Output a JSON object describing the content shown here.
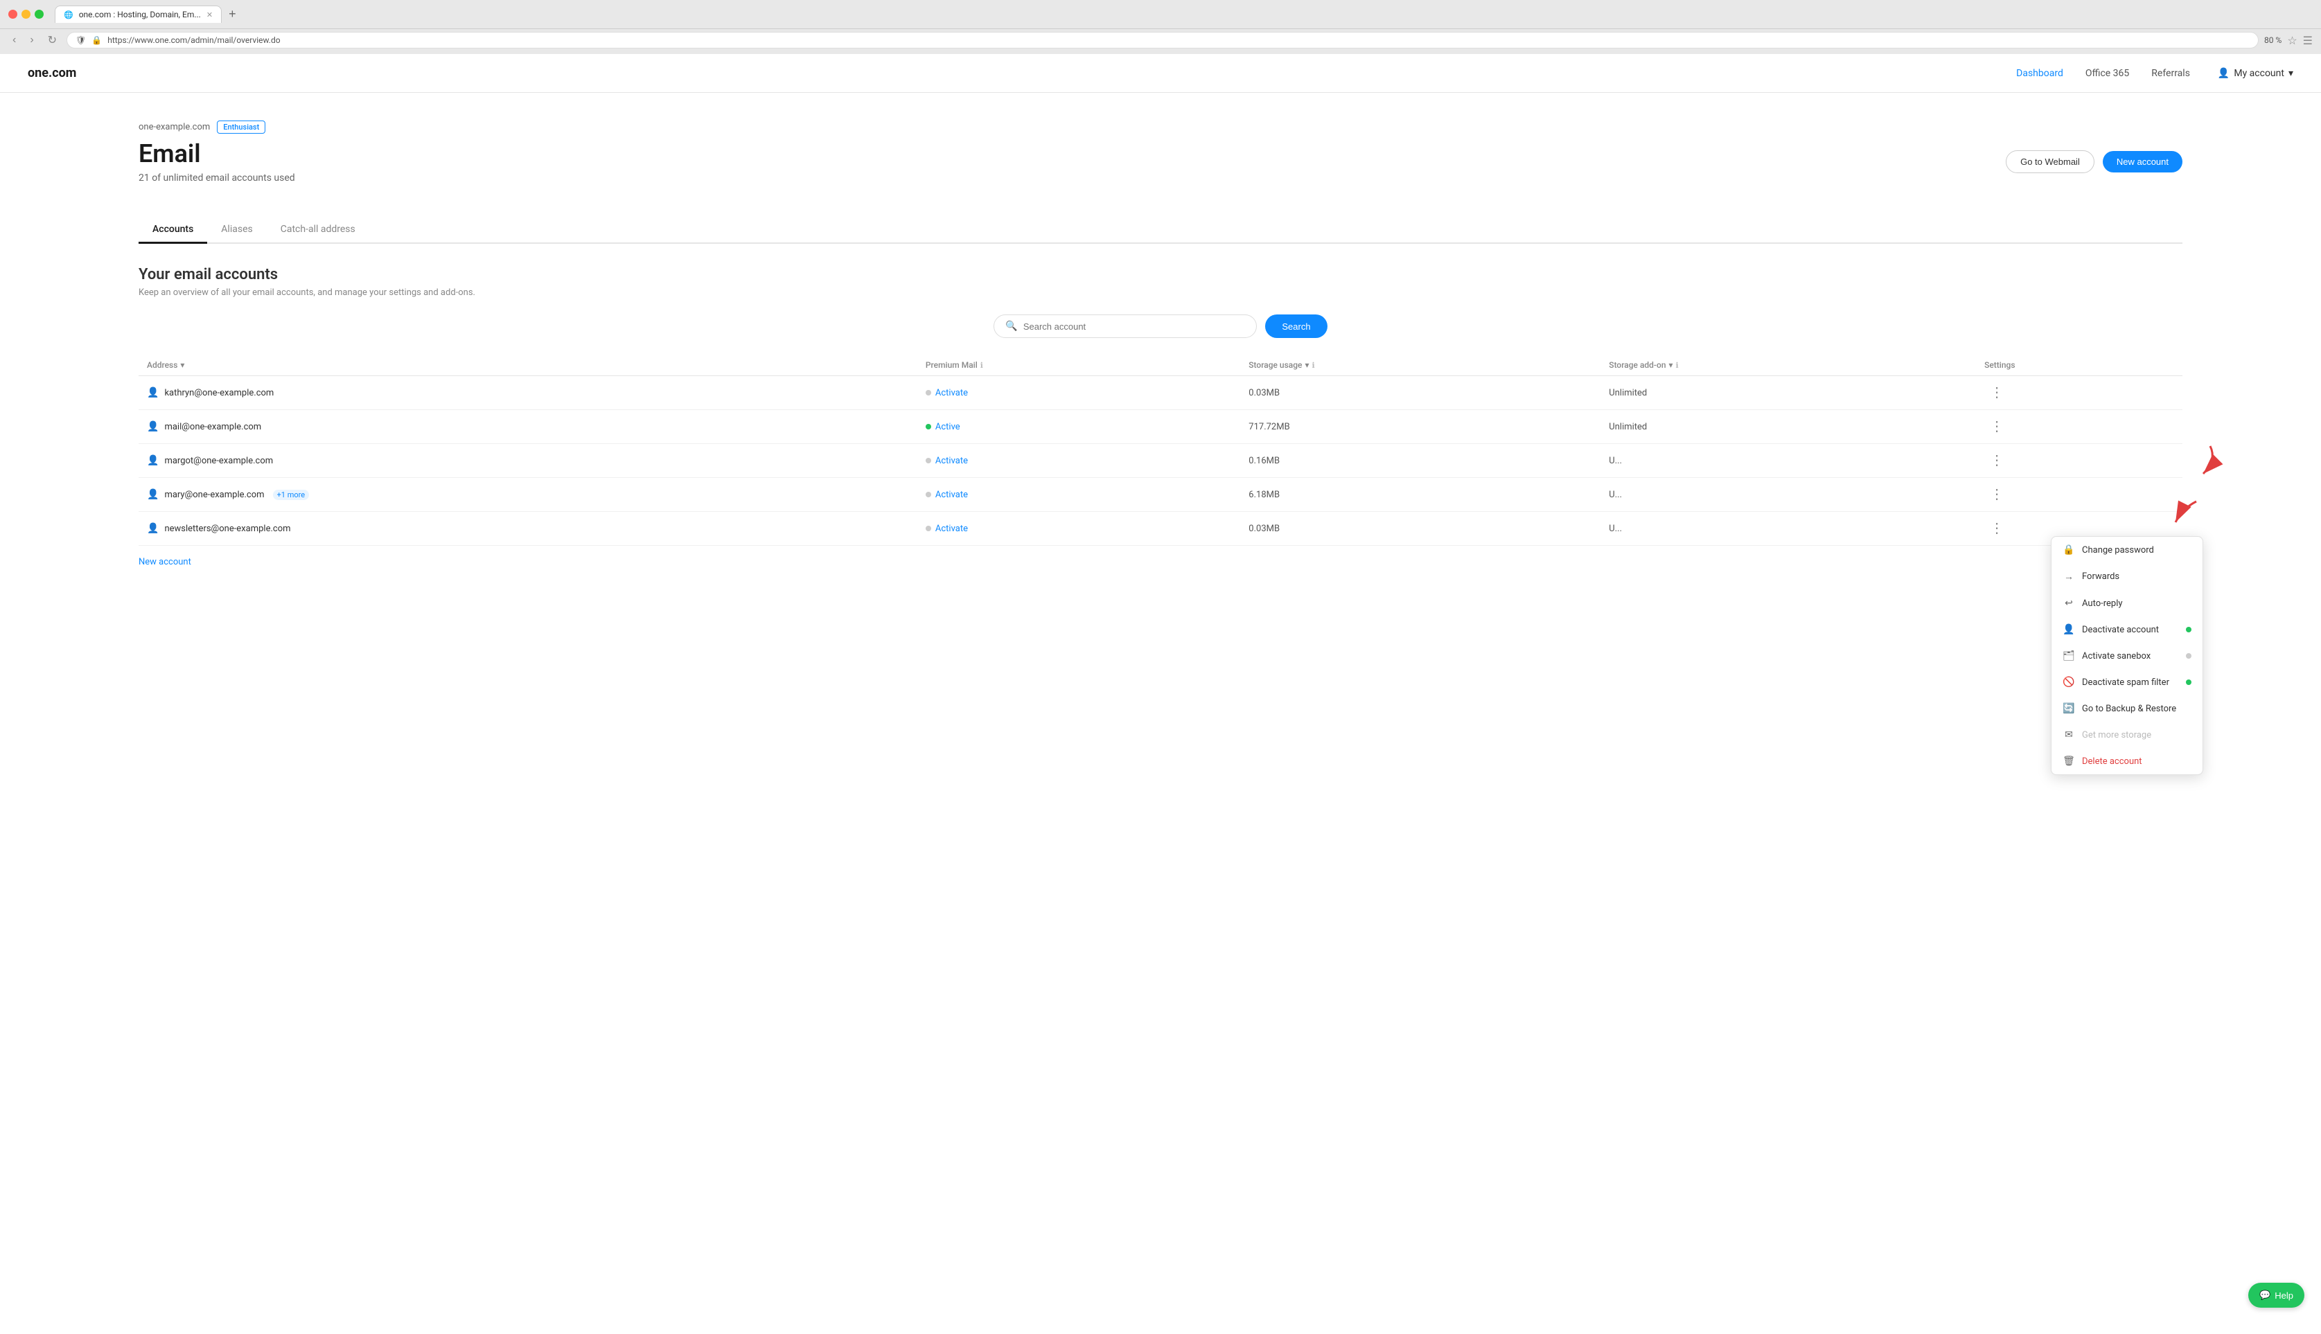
{
  "browser": {
    "tab_title": "one.com : Hosting, Domain, Em...",
    "url": "https://www.one.com/admin/mail/overview.do",
    "zoom": "80 %"
  },
  "nav": {
    "logo": "one.com",
    "links": [
      {
        "label": "Dashboard",
        "active": true
      },
      {
        "label": "Office 365",
        "active": false
      },
      {
        "label": "Referrals",
        "active": false
      }
    ],
    "my_account": "My account"
  },
  "page": {
    "domain": "one-example.com",
    "badge": "Enthusiast",
    "title": "Email",
    "subtitle": "21 of unlimited email accounts used",
    "btn_webmail": "Go to Webmail",
    "btn_new": "New account"
  },
  "tabs": [
    {
      "label": "Accounts",
      "active": true
    },
    {
      "label": "Aliases",
      "active": false
    },
    {
      "label": "Catch-all address",
      "active": false
    }
  ],
  "section": {
    "title": "Your email accounts",
    "desc": "Keep an overview of all your email accounts, and manage your settings and add-ons."
  },
  "search": {
    "placeholder": "Search account",
    "button": "Search"
  },
  "table": {
    "headers": [
      {
        "label": "Address",
        "sortable": true
      },
      {
        "label": "Premium Mail",
        "info": true
      },
      {
        "label": "Storage usage",
        "info": true,
        "sortable": true
      },
      {
        "label": "Storage add-on",
        "info": true,
        "sortable": true
      },
      {
        "label": "Settings",
        "info": false
      }
    ],
    "rows": [
      {
        "address": "kathryn@one-example.com",
        "premium": "Activate",
        "premium_active": false,
        "storage": "0.03MB",
        "storage_addon": "Unlimited"
      },
      {
        "address": "mail@one-example.com",
        "premium": "Active",
        "premium_active": true,
        "storage": "717.72MB",
        "storage_addon": "Unlimited"
      },
      {
        "address": "margot@one-example.com",
        "premium": "Activate",
        "premium_active": false,
        "storage": "0.16MB",
        "storage_addon": "U..."
      },
      {
        "address": "mary@one-example.com",
        "premium": "Activate",
        "premium_active": false,
        "storage": "6.18MB",
        "storage_addon": "U...",
        "extra": "+1 more"
      },
      {
        "address": "newsletters@one-example.com",
        "premium": "Activate",
        "premium_active": false,
        "storage": "0.03MB",
        "storage_addon": "U..."
      }
    ]
  },
  "new_account_link": "New account",
  "dropdown": {
    "items": [
      {
        "label": "Change password",
        "icon": "🔒",
        "indicator": null
      },
      {
        "label": "Forwards",
        "icon": "→",
        "indicator": null
      },
      {
        "label": "Auto-reply",
        "icon": "↩",
        "indicator": null
      },
      {
        "label": "Deactivate account",
        "icon": "👤",
        "indicator": "green"
      },
      {
        "label": "Activate sanebox",
        "icon": "🗂",
        "indicator": "gray"
      },
      {
        "label": "Deactivate spam filter",
        "icon": "🚫",
        "indicator": "green"
      },
      {
        "label": "Go to Backup & Restore",
        "icon": "🔄",
        "indicator": null
      },
      {
        "label": "Get more storage",
        "icon": "✉",
        "indicator": null,
        "disabled": true
      },
      {
        "label": "Delete account",
        "icon": "🗑",
        "danger": true
      }
    ]
  },
  "help_btn": "Help"
}
